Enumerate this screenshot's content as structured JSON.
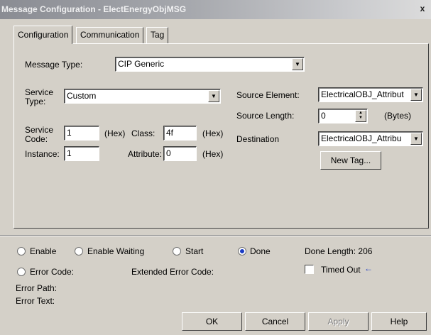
{
  "window": {
    "title": "Message Configuration - ElectEnergyObjMSG",
    "close_glyph": "x"
  },
  "tabs": [
    "Configuration",
    "Communication",
    "Tag"
  ],
  "config": {
    "message_type_label": "Message Type:",
    "message_type_value": "CIP Generic",
    "service_type_label": "Service Type:",
    "service_type_value": "Custom",
    "service_code_label": "Service Code:",
    "service_code_value": "1",
    "hex1": "(Hex)",
    "class_label": "Class:",
    "class_value": "4f",
    "hex2": "(Hex)",
    "instance_label": "Instance:",
    "instance_value": "1",
    "attribute_label": "Attribute:",
    "attribute_value": "0",
    "hex3": "(Hex)",
    "source_element_label": "Source Element:",
    "source_element_value": "ElectricalOBJ_Attribut",
    "source_length_label": "Source Length:",
    "source_length_value": "0",
    "bytes_label": "(Bytes)",
    "destination_label": "Destination",
    "destination_value": "ElectricalOBJ_Attribu",
    "new_tag_label": "New Tag..."
  },
  "status": {
    "enable": "Enable",
    "enable_waiting": "Enable Waiting",
    "start": "Start",
    "done": "Done",
    "done_length_label": "Done Length: 206",
    "error_code_label": "Error Code:",
    "extended_error_label": "Extended Error Code:",
    "timed_out_label": "Timed Out",
    "timed_out_arrow": "←",
    "error_path_label": "Error Path:",
    "error_text_label": "Error Text:"
  },
  "buttons": {
    "ok": "OK",
    "cancel": "Cancel",
    "apply": "Apply",
    "help": "Help"
  },
  "colors": {
    "dialog_bg": "#d4d0c8",
    "radio_selected": "#1a3bc4",
    "arrow_blue": "#1a3bc4"
  }
}
